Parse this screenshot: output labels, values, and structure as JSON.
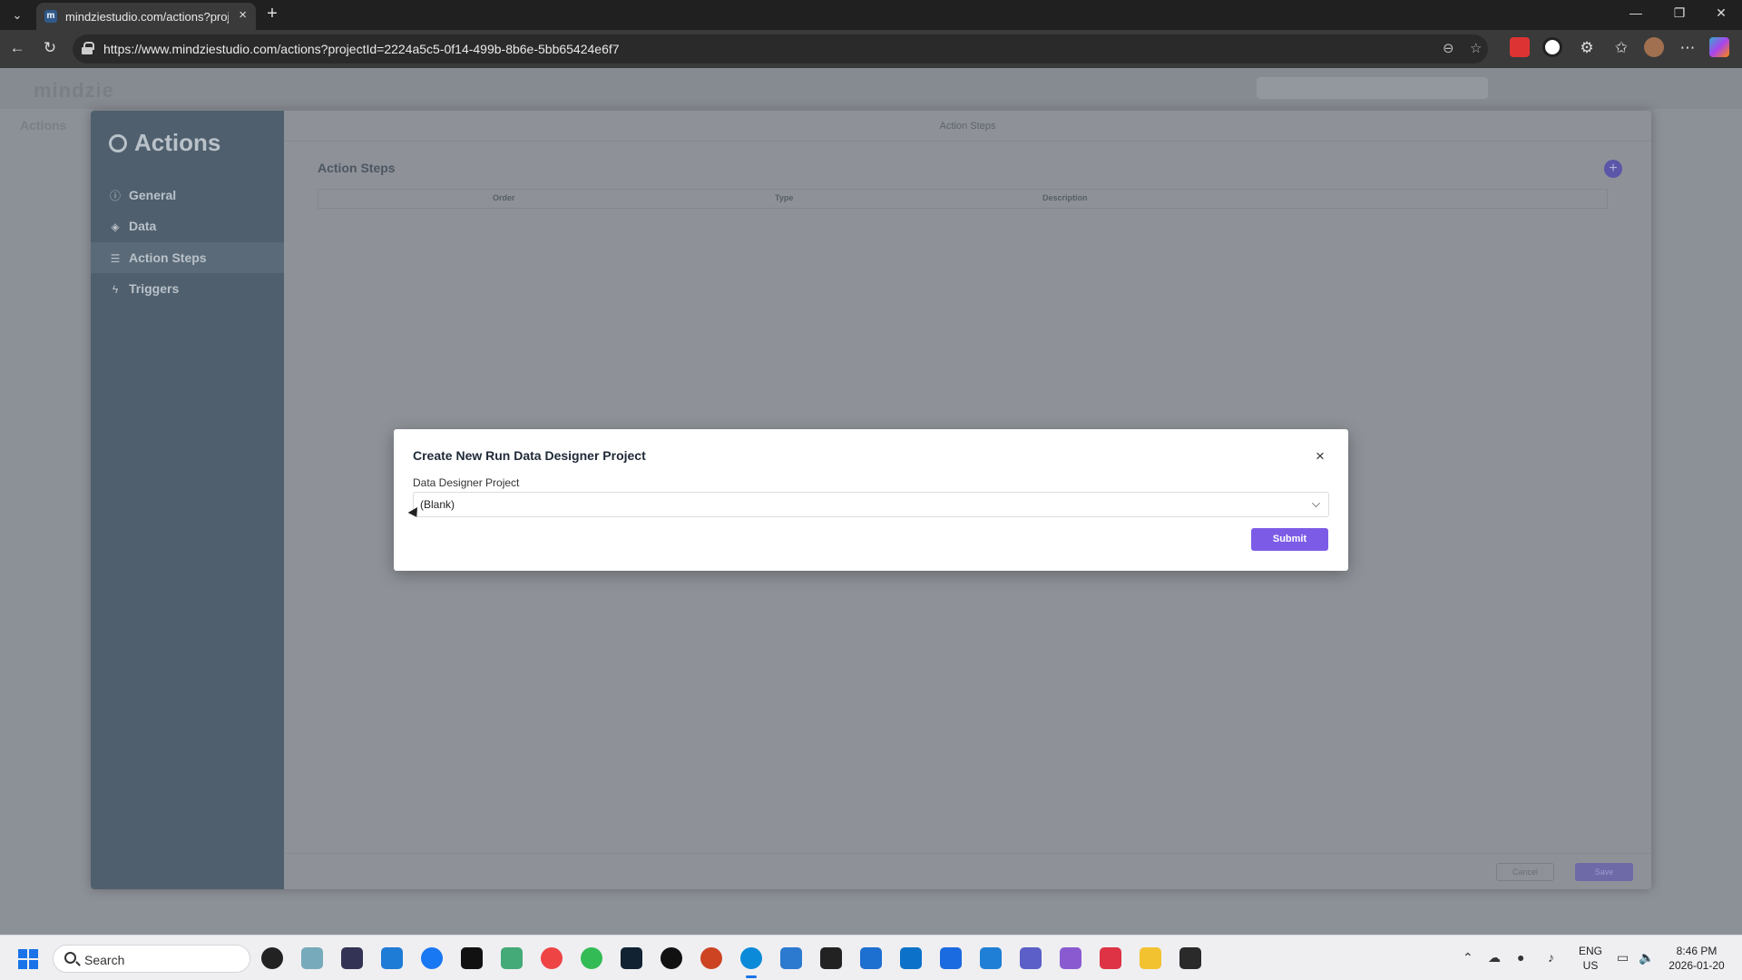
{
  "browser": {
    "tab_title": "mindziestudio.com/actions?proje",
    "url": "https://www.mindziestudio.com/actions?projectId=2224a5c5-0f14-499b-8b6e-5bb65424e6f7"
  },
  "app": {
    "logo": "mindzie",
    "page_peek": "Actions"
  },
  "actions_panel": {
    "title": "Actions",
    "sidebar": [
      {
        "label": "General",
        "icon": "info-circle-icon"
      },
      {
        "label": "Data",
        "icon": "data-icon"
      },
      {
        "label": "Action Steps",
        "icon": "list-icon",
        "active": true
      },
      {
        "label": "Triggers",
        "icon": "lightning-icon"
      }
    ],
    "top_label": "Action Steps",
    "heading": "Action Steps",
    "columns": [
      "Order",
      "Type",
      "Description"
    ],
    "cancel_label": "Cancel",
    "save_label": "Save"
  },
  "modal": {
    "title": "Create New Run Data Designer Project",
    "field_label": "Data Designer Project",
    "selected_value": "(Blank)",
    "submit_label": "Submit",
    "close_glyph": "×"
  },
  "taskbar": {
    "search_placeholder": "Search",
    "language": "ENG",
    "region": "US",
    "time": "8:46 PM",
    "date": "2026-01-20"
  },
  "colors": {
    "accent": "#7c5ce6",
    "sidebar": "#4f5f6d",
    "overlay": "#8e9298"
  }
}
